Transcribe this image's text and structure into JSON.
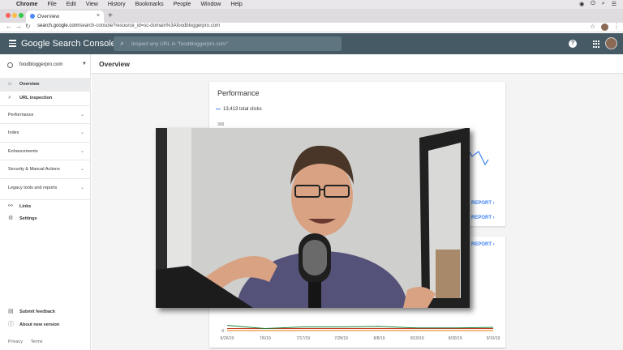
{
  "macos": {
    "menu": [
      "Chrome",
      "File",
      "Edit",
      "View",
      "History",
      "Bookmarks",
      "People",
      "Window",
      "Help"
    ]
  },
  "browser": {
    "tab_title": "Overview",
    "url_host": "search.google.com",
    "url_path": "/search-console?resource_id=sc-domain%3Afoodbloggerpro.com"
  },
  "header": {
    "brand": "Google Search Console",
    "search_placeholder": "Inspect any URL in \"foodbloggerpro.com\""
  },
  "sidebar": {
    "property": "foodbloggerpro.com",
    "items": [
      {
        "label": "Overview",
        "icon": "home-icon"
      },
      {
        "label": "URL inspection",
        "icon": "search-icon"
      }
    ],
    "sections": [
      "Performance",
      "Index",
      "Enhancements",
      "Security & Manual Actions",
      "Legacy tools and reports"
    ],
    "bottom_items": [
      {
        "label": "Links",
        "icon": "links-icon"
      },
      {
        "label": "Settings",
        "icon": "gear-icon"
      }
    ],
    "feedback": [
      {
        "label": "Submit feedback",
        "icon": "feedback-icon"
      },
      {
        "label": "About new version",
        "icon": "info-icon"
      }
    ],
    "footer": {
      "privacy": "Privacy",
      "terms": "Terms"
    }
  },
  "main": {
    "title": "Overview",
    "performance": {
      "title": "Performance",
      "legend": "13,413 total clicks",
      "y_top_tick": "300",
      "open_report": "REPORT"
    },
    "coverage": {
      "open_report": "REPORT"
    }
  },
  "chart_data": {
    "type": "line",
    "x": [
      "6/26/19",
      "7/6/19",
      "7/17/19",
      "7/28/19",
      "8/8/19",
      "8/19/19",
      "8/30/19",
      "9/10/19"
    ],
    "yticks": [
      "0",
      "300"
    ],
    "series": [
      {
        "color": "#c23b22",
        "values": [
          8,
          8,
          8,
          8,
          8,
          8,
          8,
          8
        ]
      },
      {
        "color": "#188038",
        "values": [
          20,
          8,
          14,
          14,
          16,
          10,
          10,
          12
        ]
      },
      {
        "color": "#e37400",
        "values": [
          0,
          0,
          0,
          0,
          0,
          0,
          0,
          0
        ]
      }
    ],
    "ylim": [
      0,
      300
    ]
  },
  "colors": {
    "header_bg": "#455a64",
    "accent": "#4285f4"
  }
}
